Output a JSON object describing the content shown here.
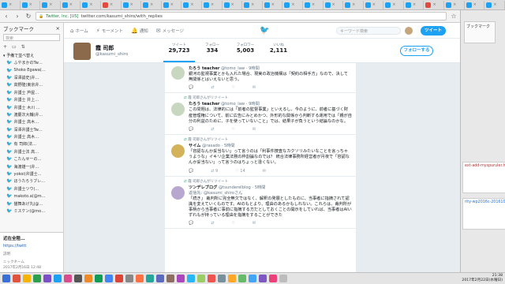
{
  "browser": {
    "tabs": [
      {
        "label": "",
        "color": "#1da1f2"
      },
      {
        "label": "",
        "color": "#1da1f2"
      },
      {
        "label": "",
        "color": "#1da1f2"
      },
      {
        "label": "",
        "color": "#1da1f2"
      },
      {
        "label": "",
        "color": "#1da1f2"
      },
      {
        "label": "",
        "color": "#e04a3f"
      },
      {
        "label": "",
        "color": "#1da1f2"
      },
      {
        "label": "",
        "color": "#1da1f2"
      },
      {
        "label": "",
        "color": "#1da1f2"
      },
      {
        "label": "",
        "color": "#1da1f2"
      },
      {
        "label": "",
        "color": "#1da1f2"
      },
      {
        "label": "",
        "color": "#1da1f2"
      },
      {
        "label": "",
        "color": "#1da1f2"
      },
      {
        "label": "",
        "color": "#1da1f2"
      },
      {
        "label": "",
        "color": "#1da1f2"
      },
      {
        "label": "",
        "color": "#1da1f2"
      },
      {
        "label": "",
        "color": "#1da1f2"
      },
      {
        "label": "",
        "color": "#1da1f2"
      },
      {
        "label": "",
        "color": "#1da1f2"
      },
      {
        "label": "",
        "color": "#1da1f2"
      },
      {
        "label": "",
        "color": "#1da1f2"
      },
      {
        "label": "",
        "color": "#e04a3f"
      },
      {
        "label": "",
        "color": "#1da1f2"
      },
      {
        "label": "",
        "color": "#1da1f2"
      },
      {
        "label": "",
        "color": "#1da1f2"
      }
    ],
    "security_label": "Twitter, Inc. [US]",
    "url": "twitter.com/kasumi_shiro/with_replies"
  },
  "bookmarks": {
    "title": "ブックマーク",
    "close": "×",
    "search_placeholder": "検索",
    "add_label": "+",
    "folder": "予備で並べ替え",
    "items": [
      "ふやまかのTw…",
      "Shoko Egawa(…",
      "深澤諭史(弁…",
      "高野隆(東京弁…",
      "弁護士 芦屋…",
      "弁護士 井上…",
      "弁護士 木川 …",
      "渡慶次大輔(弁…",
      "弁護士 高木…",
      "深澤弁護士Tw…",
      "弁護士 高木…",
      "有 司郎(法…",
      "弁護士法 高…",
      "こたんせーの…",
      "海渡雄一(弁…",
      "yokoi(弁護士…",
      "ほうたろうブレ…",
      "弁護士ツウ(…",
      "makoto.a(@m…",
      "猫舞あげ丸(@…",
      "ミスケン(@mo…"
    ],
    "preview_title": "近在全陸…",
    "preview_url": "https://twitt",
    "preview_label": "説明",
    "preview_date": "2017年2月16日 12:48",
    "preview_section": "ニックネーム"
  },
  "twitter": {
    "nav": [
      {
        "icon": "home-icon",
        "label": "ホーム"
      },
      {
        "icon": "moments-icon",
        "label": "モーメント"
      },
      {
        "icon": "bell-icon",
        "label": "通知"
      },
      {
        "icon": "mail-icon",
        "label": "メッセージ"
      }
    ],
    "search_placeholder": "キーワード検索",
    "tweet_button": "ツイート",
    "profile": {
      "name": "霞 司郎",
      "handle": "@kasumi_shiro",
      "stats": [
        {
          "label": "ツイート",
          "value": "29,723"
        },
        {
          "label": "フォロー",
          "value": "334"
        },
        {
          "label": "フォロワー",
          "value": "5,003"
        },
        {
          "label": "いいね",
          "value": "2,111"
        }
      ],
      "follow_label": "フォローする"
    },
    "tweets": [
      {
        "retweeted_by": "",
        "name": "たろう teacher",
        "handle": "@tomo_law",
        "time": "9時間",
        "body": "銀河の監視事業とかも入れた場合、現実の政治機構は「契約の相手方」なので、決して無関係とはいえないと思う。",
        "avatar_color": "#c8d8c0",
        "replies": "",
        "retweets": "",
        "likes": ""
      },
      {
        "retweeted_by": "霞 司郎さんがリツイート",
        "name": "たろう teacher",
        "handle": "@tomo_law",
        "time": "9時間",
        "body": "この問題は、法律的には「前者の監督事業」といえるし、今のように、前者に基づく財産管理権について、前に広告にみとめかつ、外形的な関係から判断する運用では「親が自分の利益のために、子を使っていないこと」では、結果子が負うという結論なのかな。",
        "avatar_color": "#c8d8c0",
        "replies": "",
        "retweets": "",
        "likes": ""
      },
      {
        "retweeted_by": "霞 司郎さんがリツイート",
        "name": "サイム",
        "handle": "@rasado",
        "time": "5時間",
        "body": "「容認なんか妥当ない」って言うのは「利事件捜査なカクソリみたいなことを言っちゃうような」イキリ企業法務の枠割論なのでは？ 統合法律事務所経営者が月夜で「容認なんか妥当ない」って言うのはちょっと違くない。",
        "avatar_color": "#d4b25a",
        "replies": "",
        "retweets": "9",
        "likes": "14"
      },
      {
        "retweeted_by": "霞 司郎さんがリツイート",
        "name": "ツンデレブログ",
        "handle": "@tsunderelblog",
        "time": "5時間",
        "body": "「続き」 裁判所に完全無欠ではなく、解釈の発展としたものに、当事者に指摘されて認識を変えていくものです。AIのもとより、理由のあるかもしれない。これらは、裁判所が事柄から当事者に事前に指摘する方だとしておくことの開示をしていれば、当事者はAIいずれもが持っている理由を指摘をすることができた",
        "reply_to": "返信先: @kasumi_shiroさん",
        "avatar_color": "#b8a8d0",
        "replies": "",
        "retweets": "",
        "likes": ""
      }
    ]
  },
  "right_edge": {
    "panel_label": "ブックマーク",
    "link1": "ext-add-myspuruler.ht",
    "link2": "rity-wp2016c-2016101"
  },
  "taskbar": {
    "time": "21:38",
    "date": "2017年2月22日(水曜日)"
  }
}
